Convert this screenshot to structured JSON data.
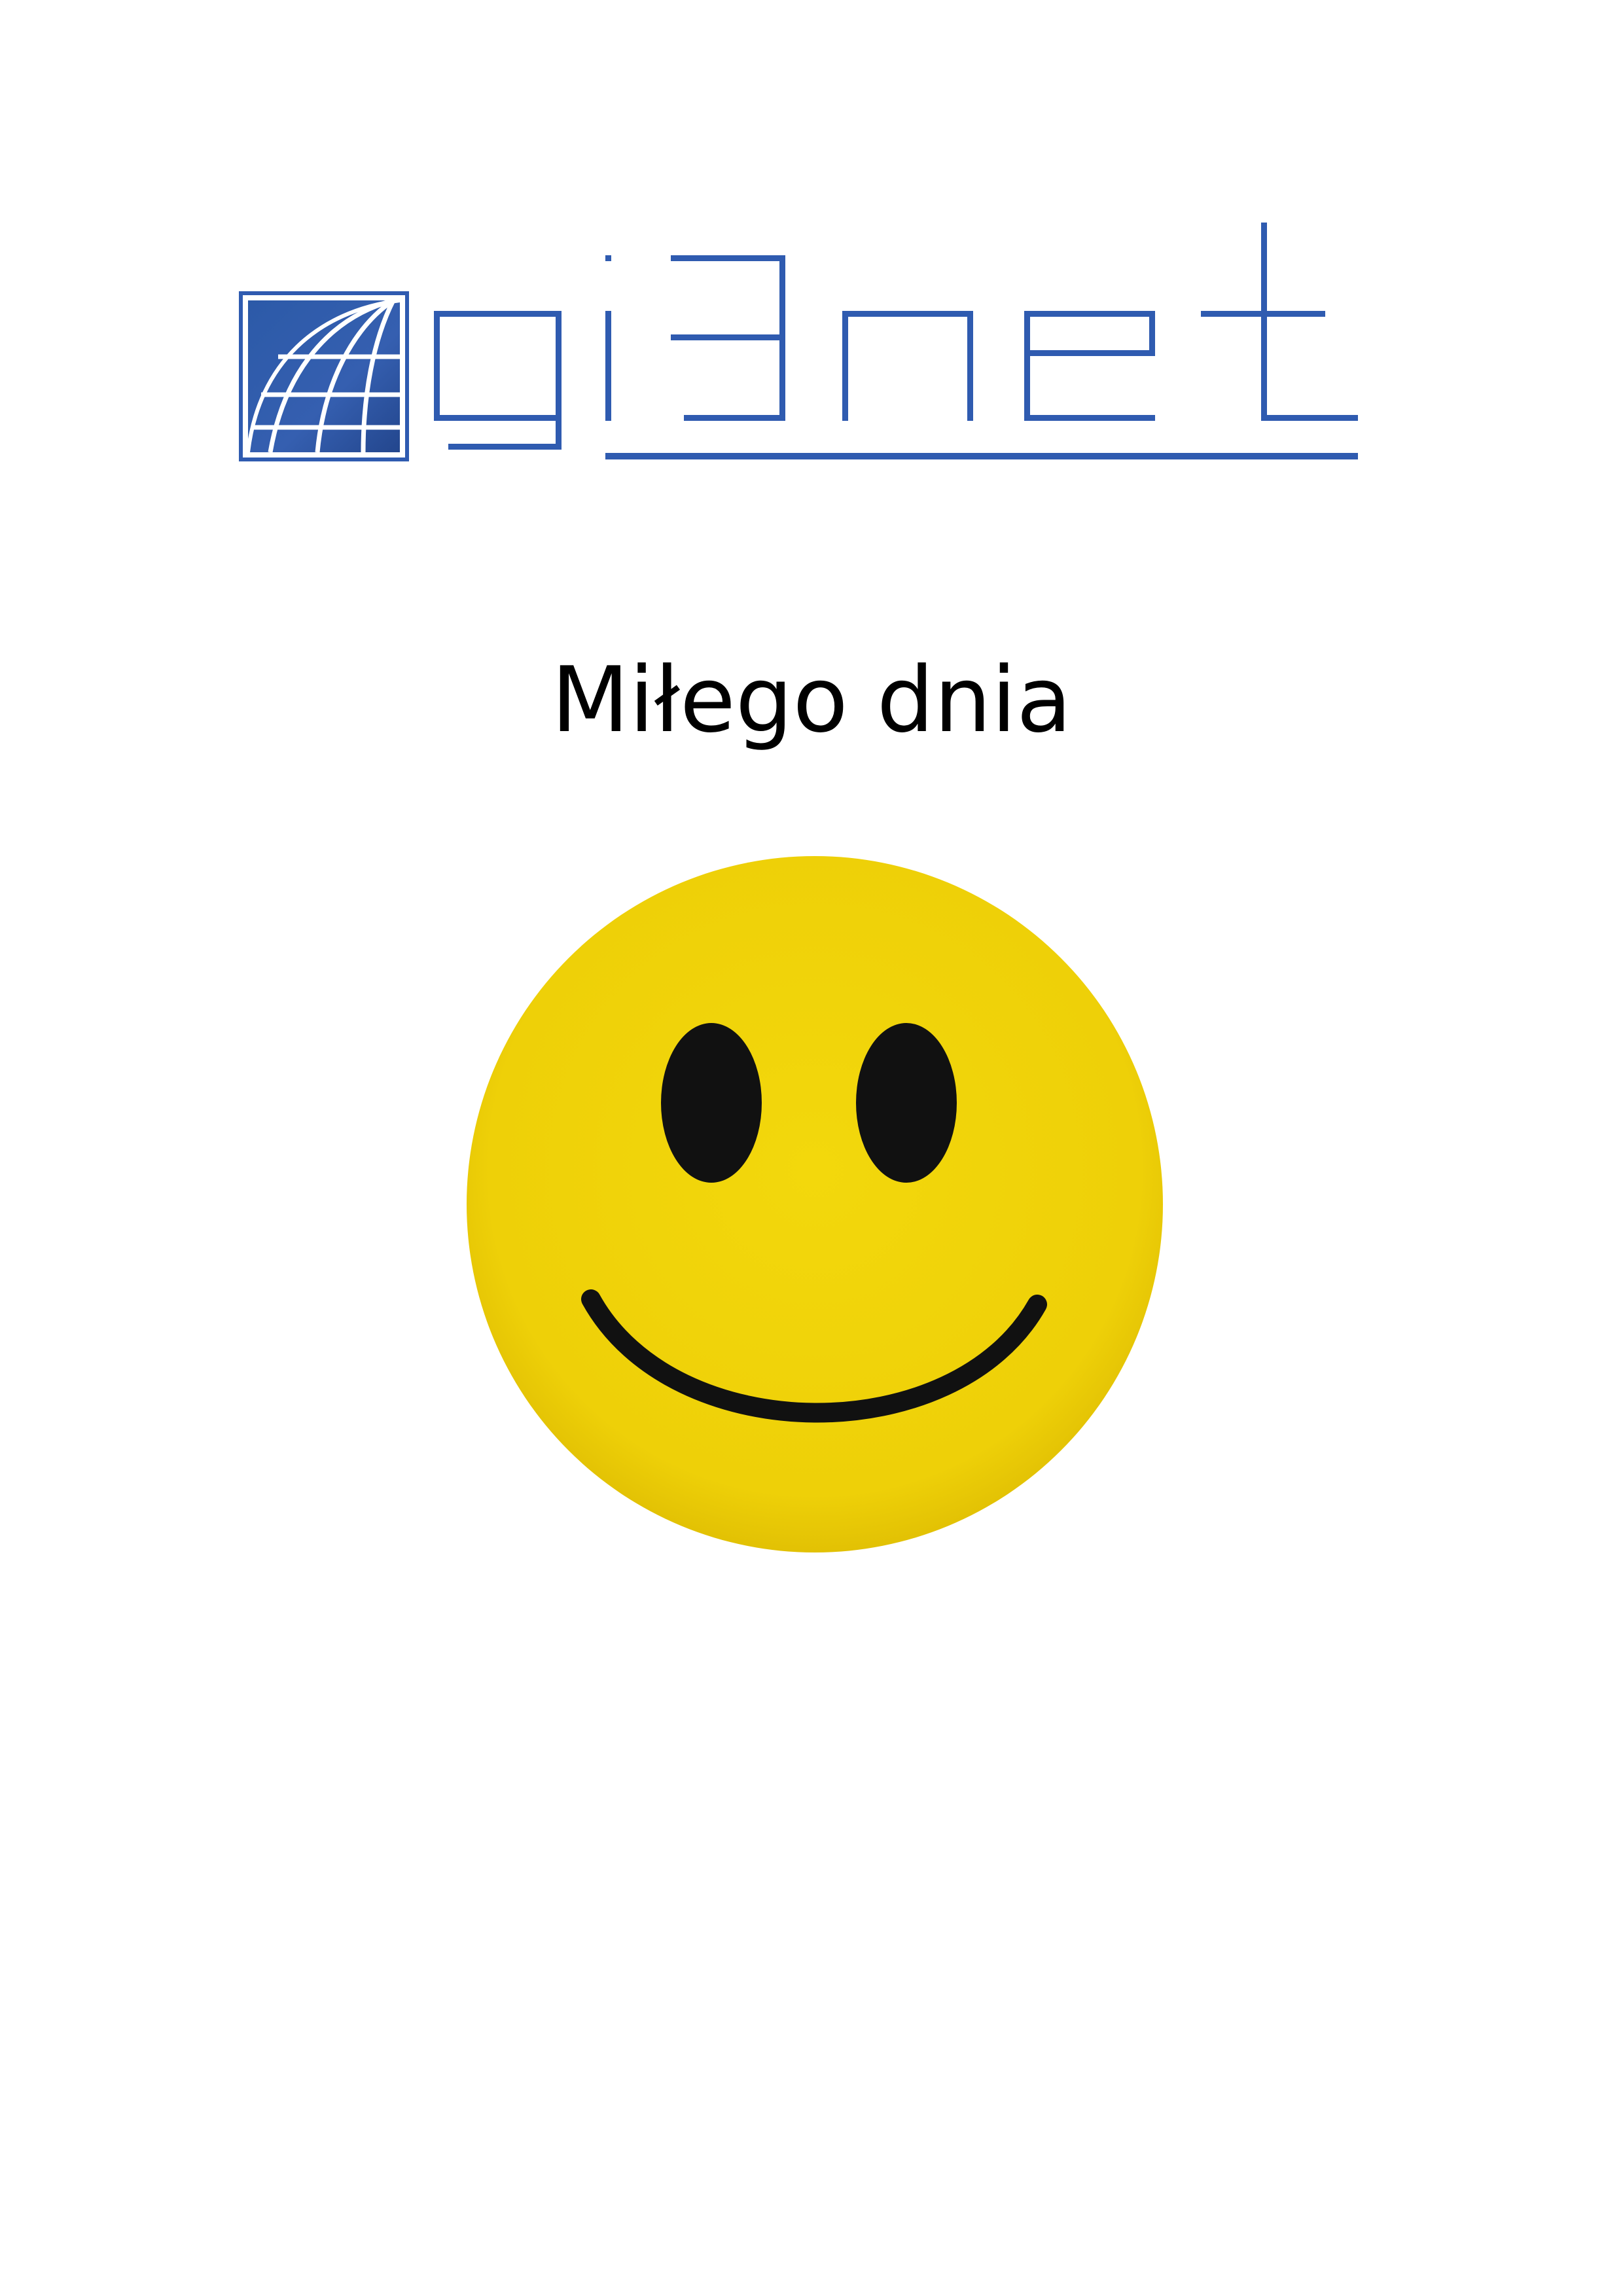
{
  "document": {
    "logo": {
      "wordmark": "gisnet",
      "brand_color": "#2f5bb0",
      "emblem_icon": "globe-grid-icon"
    },
    "greeting": "Miłego dnia",
    "illustration": {
      "icon": "smiley-face-icon",
      "face_color": "#f2d40a",
      "feature_color": "#111111"
    }
  }
}
